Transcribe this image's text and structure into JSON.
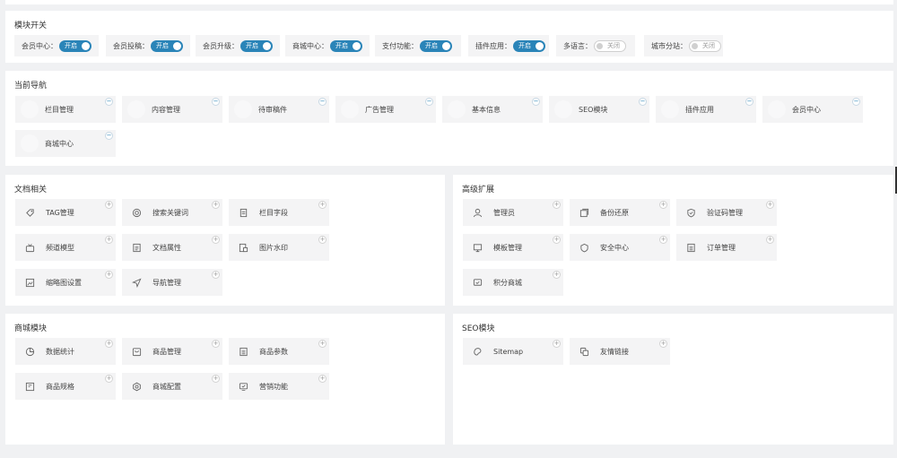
{
  "modules": {
    "title": "模块开关",
    "switches": [
      {
        "label": "会员中心：",
        "state": "开启",
        "on": true
      },
      {
        "label": "会员投稿：",
        "state": "开启",
        "on": true
      },
      {
        "label": "会员升级：",
        "state": "开启",
        "on": true
      },
      {
        "label": "商城中心：",
        "state": "开启",
        "on": true
      },
      {
        "label": "支付功能：",
        "state": "开启",
        "on": true
      },
      {
        "label": "插件应用：",
        "state": "开启",
        "on": true
      },
      {
        "label": "多语言：",
        "state": "关闭",
        "on": false
      },
      {
        "label": "城市分站：",
        "state": "关闭",
        "on": false
      }
    ]
  },
  "nav": {
    "title": "当前导航",
    "items": [
      {
        "label": "栏目管理"
      },
      {
        "label": "内容管理"
      },
      {
        "label": "待审稿件"
      },
      {
        "label": "广告管理"
      },
      {
        "label": "基本信息"
      },
      {
        "label": "SEO模块"
      },
      {
        "label": "插件应用"
      },
      {
        "label": "会员中心"
      },
      {
        "label": "商城中心"
      }
    ],
    "badge": "−"
  },
  "docs": {
    "title": "文档相关",
    "items": [
      {
        "label": "TAG管理",
        "icon": "tag-icon"
      },
      {
        "label": "搜索关键词",
        "icon": "target-icon"
      },
      {
        "label": "栏目字段",
        "icon": "document-icon"
      },
      {
        "label": "频道模型",
        "icon": "tv-icon"
      },
      {
        "label": "文档属性",
        "icon": "list-icon"
      },
      {
        "label": "图片水印",
        "icon": "image-doc-icon"
      },
      {
        "label": "缩略图设置",
        "icon": "picture-icon"
      },
      {
        "label": "导航管理",
        "icon": "send-icon"
      }
    ],
    "badge": "+"
  },
  "advanced": {
    "title": "高级扩展",
    "items": [
      {
        "label": "管理员",
        "icon": "user-icon"
      },
      {
        "label": "备份还原",
        "icon": "backup-icon"
      },
      {
        "label": "验证码管理",
        "icon": "shield-icon"
      },
      {
        "label": "模板管理",
        "icon": "monitor-icon"
      },
      {
        "label": "安全中心",
        "icon": "security-icon"
      },
      {
        "label": "订单管理",
        "icon": "order-icon"
      },
      {
        "label": "积分商城",
        "icon": "gift-screen-icon"
      }
    ],
    "badge": "+"
  },
  "shop": {
    "title": "商城模块",
    "items": [
      {
        "label": "数据统计",
        "icon": "pie-icon"
      },
      {
        "label": "商品管理",
        "icon": "bag-icon"
      },
      {
        "label": "商品参数",
        "icon": "params-icon"
      },
      {
        "label": "商品规格",
        "icon": "spec-icon"
      },
      {
        "label": "商城配置",
        "icon": "hex-gear-icon"
      },
      {
        "label": "营销功能",
        "icon": "marketing-icon"
      }
    ],
    "badge": "+"
  },
  "seo": {
    "title": "SEO模块",
    "items": [
      {
        "label": "Sitemap",
        "icon": "sitemap-icon"
      },
      {
        "label": "友情链接",
        "icon": "link-icon"
      }
    ],
    "badge": "+"
  },
  "colors": {
    "accent": "#2a84b8",
    "tile": "#f4f4f5",
    "page": "#f0f1f3"
  }
}
